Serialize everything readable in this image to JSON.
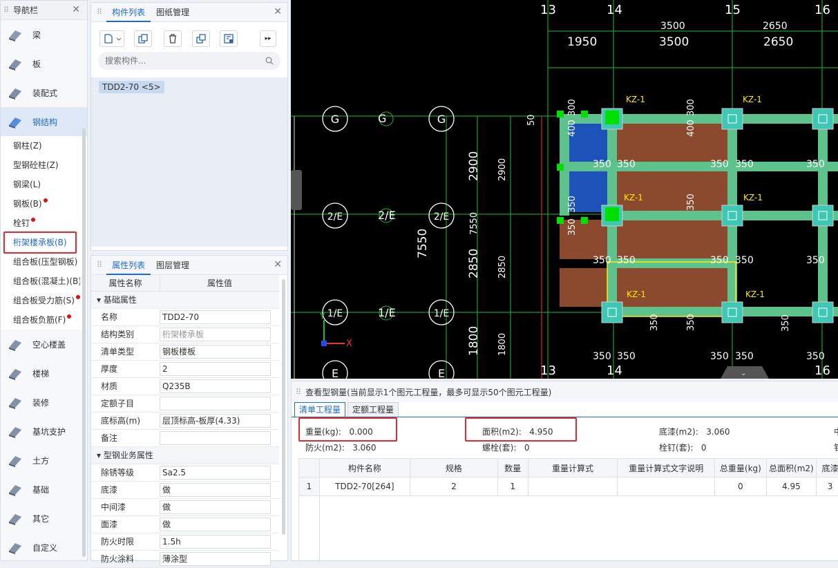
{
  "nav": {
    "title": "导航栏",
    "items": [
      {
        "label": "梁",
        "icon": "beam-icon"
      },
      {
        "label": "板",
        "icon": "slab-icon"
      },
      {
        "label": "装配式",
        "icon": "prefab-icon"
      },
      {
        "label": "钢结构",
        "icon": "steel-structure-icon"
      }
    ],
    "sub_items": [
      {
        "label": "钢柱(Z)",
        "dot": false
      },
      {
        "label": "型钢砼柱(Z)",
        "dot": false
      },
      {
        "label": "钢梁(L)",
        "dot": false
      },
      {
        "label": "钢板(B)",
        "dot": true
      },
      {
        "label": "栓钉",
        "dot": true
      },
      {
        "label": "桁架楼承板(B)",
        "dot": false
      },
      {
        "label": "组合板(压型钢板)",
        "dot": false
      },
      {
        "label": "组合板(混凝土)(B)",
        "dot": false
      },
      {
        "label": "组合板受力筋(S)",
        "dot": true
      },
      {
        "label": "组合板负筋(F)",
        "dot": true
      }
    ],
    "more_items": [
      {
        "label": "空心楼盖",
        "icon": "hollow-floor-icon"
      },
      {
        "label": "楼梯",
        "icon": "stairs-icon"
      },
      {
        "label": "装修",
        "icon": "decoration-icon"
      },
      {
        "label": "基坑支护",
        "icon": "pit-support-icon"
      },
      {
        "label": "土方",
        "icon": "earthwork-icon"
      },
      {
        "label": "基础",
        "icon": "foundation-icon"
      },
      {
        "label": "其它",
        "icon": "other-icon"
      },
      {
        "label": "自定义",
        "icon": "custom-icon"
      }
    ]
  },
  "component_panel": {
    "tab_active": "构件列表",
    "tab_other": "图纸管理",
    "search_placeholder": "搜索构件...",
    "item": "TDD2-70 <5>"
  },
  "property_panel": {
    "tab_active": "属性列表",
    "tab_other": "图层管理",
    "col_name": "属性名称",
    "col_value": "属性值",
    "group1": "基础属性",
    "group2": "型钢业务属性",
    "rows1": [
      {
        "k": "名称",
        "v": "TDD2-70",
        "blue": true,
        "gray": false
      },
      {
        "k": "结构类别",
        "v": "桁架楼承板",
        "blue": true,
        "gray": true
      },
      {
        "k": "清单类型",
        "v": "钢板楼板",
        "blue": false,
        "gray": false
      },
      {
        "k": "厚度",
        "v": "2",
        "blue": false,
        "gray": false
      },
      {
        "k": "材质",
        "v": "Q235B",
        "blue": false,
        "gray": false
      },
      {
        "k": "定额子目",
        "v": "",
        "blue": false,
        "gray": false
      },
      {
        "k": "底标高(m)",
        "v": "层顶标高-板厚(4.33)",
        "blue": false,
        "gray": false
      },
      {
        "k": "备注",
        "v": "",
        "blue": false,
        "gray": false
      }
    ],
    "rows2": [
      {
        "k": "除锈等级",
        "v": "Sa2.5"
      },
      {
        "k": "底漆",
        "v": "做"
      },
      {
        "k": "中间漆",
        "v": "做"
      },
      {
        "k": "面漆",
        "v": "做"
      },
      {
        "k": "防火时限",
        "v": "1.5h"
      },
      {
        "k": "防火涂料",
        "v": "薄涂型"
      }
    ]
  },
  "cad": {
    "axis_top": [
      "13",
      "14",
      "15",
      "16"
    ],
    "axis_bottom": [
      "13",
      "14",
      "16"
    ],
    "dims_top1": [
      "3500",
      "2650"
    ],
    "dims_top2": [
      "1950",
      "3500",
      "2650"
    ],
    "row_labels": [
      "G",
      "2/E",
      "1/E",
      "E"
    ],
    "vdims_big": [
      "2900",
      "2850",
      "1800"
    ],
    "vdims_small": [
      "2900",
      "7550",
      "2850",
      "1800"
    ],
    "vtotal": "7550",
    "kz": "KZ-1",
    "d350": "350",
    "d300": "300",
    "d400": "400",
    "d50": "50",
    "ucs_y": "Y",
    "ucs_x": "X"
  },
  "steel": {
    "title": "查看型钢量(当前显示1个图元工程量，最多可显示50个图元工程量)",
    "tab_active": "清单工程量",
    "tab_other": "定额工程量",
    "s1": [
      {
        "k": "重量(kg):",
        "v": "0.000"
      },
      {
        "k": "面积(m2):",
        "v": "4.950"
      },
      {
        "k": "底漆(m2):",
        "v": "3.060"
      },
      {
        "k": "中",
        "v": ""
      }
    ],
    "s2": [
      {
        "k": "防火(m2):",
        "v": "3.060"
      },
      {
        "k": "螺栓(套):",
        "v": "0"
      },
      {
        "k": "栓钉(套):",
        "v": "0"
      },
      {
        "k": "钅",
        "v": ""
      }
    ],
    "headers": [
      "构件名称",
      "规格",
      "数量",
      "重量计算式",
      "重量计算式文字说明",
      "总重量(kg)",
      "总面积(m2)",
      "底漆"
    ],
    "rows": [
      [
        "1",
        "TDD2-70[264]",
        "2",
        "1",
        "",
        "",
        "0",
        "4.95",
        "3"
      ]
    ]
  },
  "colors": {
    "accent": "#1f6bc4",
    "highlight": "#e8262b",
    "cad_bg": "#000000",
    "beam": "#5ec28c",
    "slab": "#8b4a2d",
    "selected": "#1d52b8"
  }
}
